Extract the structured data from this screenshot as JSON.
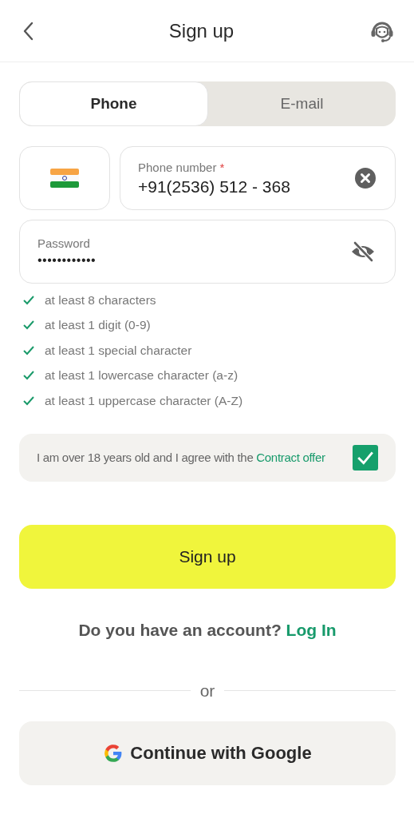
{
  "header": {
    "title": "Sign up"
  },
  "tabs": [
    {
      "label": "Phone",
      "selected": true
    },
    {
      "label": "E-mail",
      "selected": false
    }
  ],
  "phone": {
    "label": "Phone number",
    "required_mark": "*",
    "value": "+91(2536) 512 - 368"
  },
  "password": {
    "label": "Password",
    "value": "••••••••••••",
    "hidden": true
  },
  "rules": [
    {
      "text": "at least 8 characters",
      "checked": true
    },
    {
      "text": "at least 1 digit (0-9)",
      "checked": true
    },
    {
      "text": "at least 1 special character",
      "checked": true
    },
    {
      "text": "at least 1 lowercase character (a-z)",
      "checked": true
    },
    {
      "text": "at least 1 uppercase character (A-Z)",
      "checked": true
    }
  ],
  "agreement": {
    "text": "I am over 18 years old and I agree with the",
    "link": "Contract offer",
    "checked": true
  },
  "submit": "Sign up",
  "login_prompt": {
    "text": "Do you have an account?",
    "link": "Log In"
  },
  "divider": "or",
  "google_button": "Continue with Google"
}
